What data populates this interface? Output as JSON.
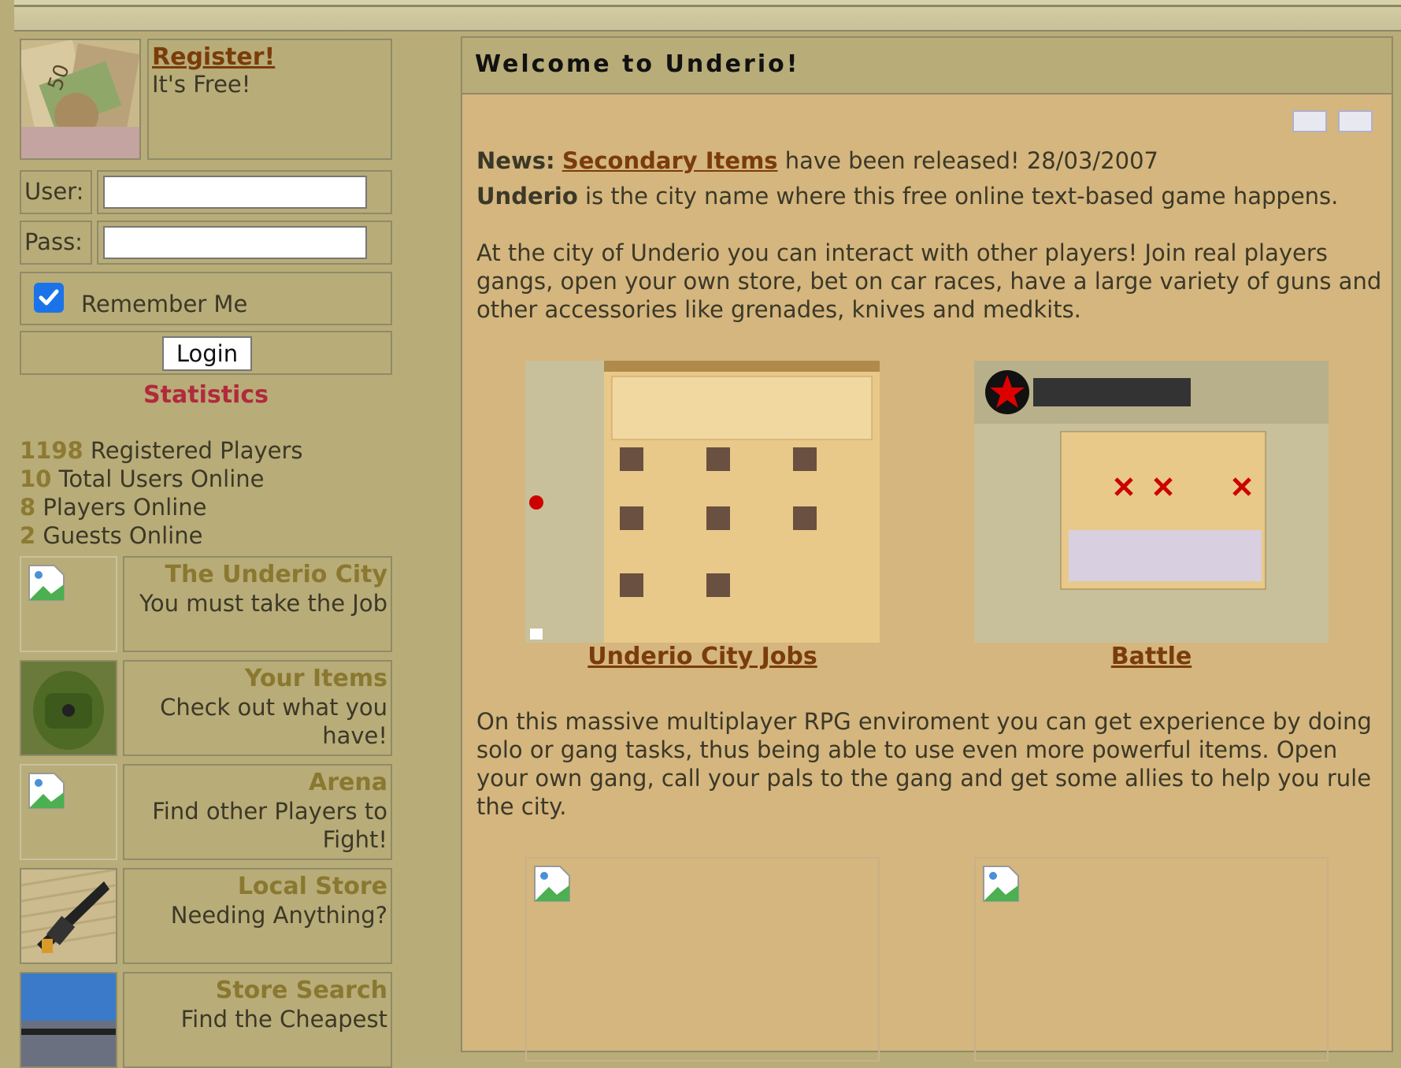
{
  "login": {
    "register_label": "Register!",
    "register_sub": "It's Free!",
    "user_label": "User:",
    "pass_label": "Pass:",
    "user_value": "",
    "pass_value": "",
    "remember_label": "Remember Me",
    "remember_checked": true,
    "login_button": "Login"
  },
  "stats": {
    "title": "Statistics",
    "rows": [
      {
        "count": "1198",
        "label": " Registered Players"
      },
      {
        "count": "10",
        "label": " Total Users Online"
      },
      {
        "count": "8",
        "label": " Players Online"
      },
      {
        "count": "2",
        "label": " Guests Online"
      }
    ]
  },
  "nav": [
    {
      "title": "The Underio City",
      "desc": "You must take the Job"
    },
    {
      "title": "Your Items",
      "desc": "Check out what you have!"
    },
    {
      "title": "Arena",
      "desc": "Find other Players to Fight!"
    },
    {
      "title": "Local Store",
      "desc": "Needing Anything?"
    },
    {
      "title": "Store Search",
      "desc": "Find the Cheapest"
    }
  ],
  "main": {
    "title": "Welcome to Underio!",
    "news_label": "News:",
    "news_link": "Secondary Items",
    "news_text": " have been released! 28/03/2007",
    "intro_bold": "Underio",
    "intro_text": " is the city name where this free online text-based game happens.",
    "para1": "At the city of Underio you can interact with other players! Join real players gangs, open your own store, bet on car races, have a large variety of guns and other accessories like grenades, knives and medkits.",
    "screens": [
      {
        "caption": "Underio City Jobs"
      },
      {
        "caption": "Battle"
      }
    ],
    "para2": "On this massive multiplayer RPG enviroment you can get experience by doing solo or gang tasks, thus being able to use even more powerful items. Open your own gang, call your pals to the gang and get some allies to help you rule the city."
  },
  "colors": {
    "page_bg": "#b8ac78",
    "main_bg": "#d4b67e",
    "link": "#7a3c0a",
    "nav_title": "#8a7830",
    "stats_title": "#b02a3c"
  }
}
